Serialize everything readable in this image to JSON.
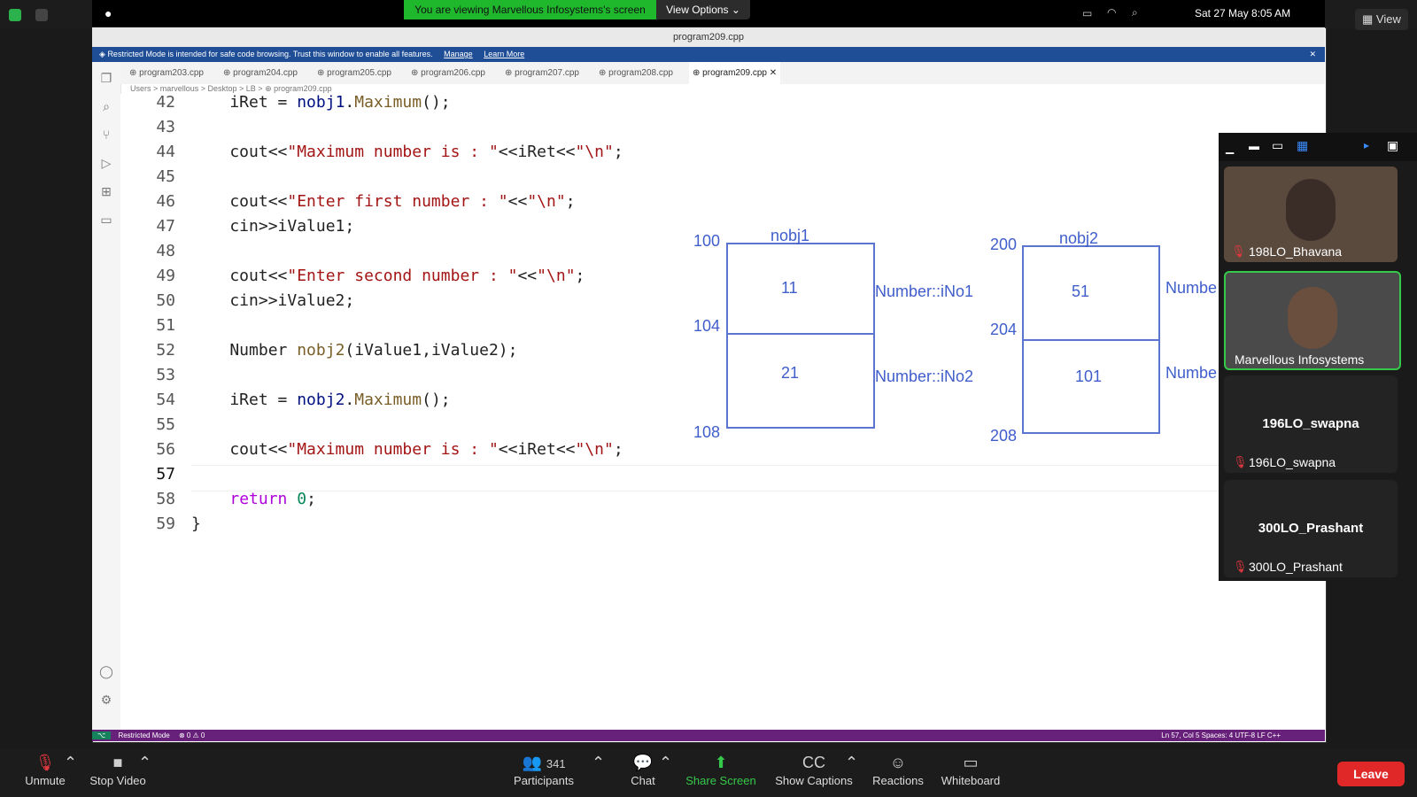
{
  "zoom_top": {
    "view_label": "View"
  },
  "mac_menubar": {
    "share_banner": "You are viewing Marvellous Infosystems's screen",
    "view_options": "View Options",
    "datetime": "Sat 27 May  8:05 AM"
  },
  "vscode": {
    "title": "program209.cpp",
    "restricted_message": "Restricted Mode is intended for safe code browsing. Trust this window to enable all features.",
    "restricted_manage": "Manage",
    "restricted_learn": "Learn More",
    "tabs": [
      "program203.cpp",
      "program204.cpp",
      "program205.cpp",
      "program206.cpp",
      "program207.cpp",
      "program208.cpp",
      "program209.cpp"
    ],
    "breadcrumbs": "Users > marvellous > Desktop > LB > ⊕ program209.cpp",
    "status_left_mode": "Restricted Mode",
    "status_left_problems": "⊗ 0 ⚠ 0",
    "status_right": "Ln 57, Col 5    Spaces: 4    UTF-8    LF    C++"
  },
  "code": {
    "line_numbers": [
      "42",
      "43",
      "44",
      "45",
      "46",
      "47",
      "48",
      "49",
      "50",
      "51",
      "52",
      "53",
      "54",
      "55",
      "56",
      "57",
      "58",
      "59"
    ]
  },
  "diagram": {
    "obj1_name": "nobj1",
    "obj1_addr_start": "100",
    "obj1_addr_mid": "104",
    "obj1_addr_end": "108",
    "obj1_val1": "11",
    "obj1_val2": "21",
    "obj1_label1": "Number::iNo1",
    "obj1_label2": "Number::iNo2",
    "obj2_name": "nobj2",
    "obj2_addr_start": "200",
    "obj2_addr_mid": "204",
    "obj2_addr_end": "208",
    "obj2_val1": "51",
    "obj2_val2": "101",
    "obj2_label1": "Numbe",
    "obj2_label2": "Numbe"
  },
  "participants": [
    {
      "name": "198LO_Bhavana",
      "muted": true
    },
    {
      "name": "Marvellous Infosystems",
      "muted": false
    },
    {
      "name": "196LO_swapna",
      "display": "196LO_swapna",
      "muted": true
    },
    {
      "name": "300LO_Prashant",
      "display": "300LO_Prashant",
      "muted": true
    }
  ],
  "bottom_bar": {
    "unmute": "Unmute",
    "stop_video": "Stop Video",
    "participants_label": "Participants",
    "participants_count": "341",
    "chat": "Chat",
    "share_screen": "Share Screen",
    "show_captions": "Show Captions",
    "reactions": "Reactions",
    "whiteboard": "Whiteboard",
    "leave": "Leave"
  }
}
